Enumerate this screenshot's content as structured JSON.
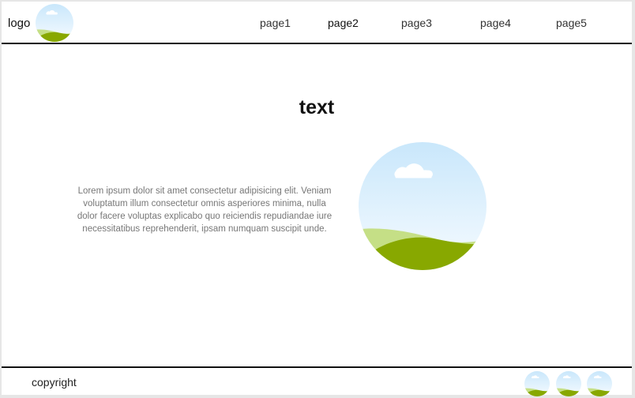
{
  "header": {
    "logo_text": "logo",
    "nav": [
      {
        "label": "page1"
      },
      {
        "label": "page2"
      },
      {
        "label": "page3"
      },
      {
        "label": "page4"
      },
      {
        "label": "page5"
      }
    ]
  },
  "main": {
    "title": "text",
    "paragraph": "Lorem ipsum dolor sit amet consectetur adipisicing elit. Veniam voluptatum illum consectetur omnis asperiores minima, nulla dolor facere voluptas explicabo quo reiciendis repudiandae iure necessitatibus reprehenderit, ipsam numquam suscipit unde.",
    "image_icon": "landscape-image-icon"
  },
  "footer": {
    "copyright": "copyright",
    "social_icons": [
      "landscape-image-icon",
      "landscape-image-icon",
      "landscape-image-icon"
    ]
  },
  "colors": {
    "sky_top": "#cfeafc",
    "sky_bottom": "#f2f9ff",
    "hill_light": "#c5df86",
    "hill_dark": "#88a800",
    "border": "#111111"
  }
}
